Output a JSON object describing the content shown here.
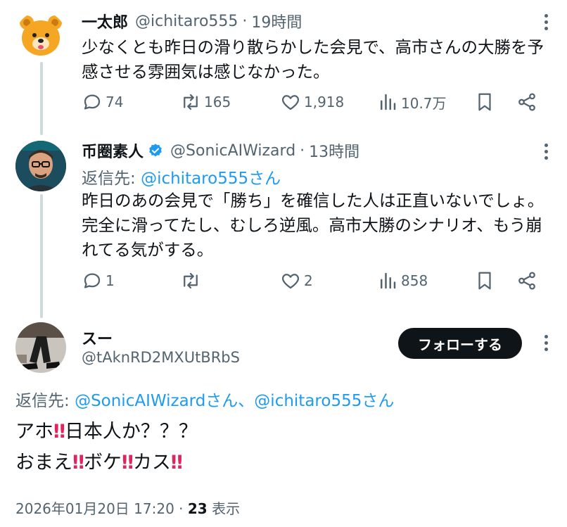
{
  "tweets": [
    {
      "name": "一太郎",
      "handle": "@ichitaro555",
      "dot": "·",
      "time": "19時間",
      "text_lines": [
        "少なくとも昨日の滑り散らかした会見で、高市さんの大勝を予",
        "感させる雰囲気は感じなかった。"
      ],
      "actions": {
        "reply": "74",
        "retweet": "165",
        "like": "1,918",
        "views": "10.7万"
      }
    },
    {
      "name": "币圈素人",
      "verified": true,
      "handle": "@SonicAIWizard",
      "dot": "·",
      "time": "13時間",
      "reply_prefix": "返信先: ",
      "reply_target": "@ichitaro555さん",
      "text_lines": [
        "昨日のあの会見で「勝ち」を確信した人は正直いないでしょ。",
        "完全に滑ってたし、むしろ逆風。高市大勝のシナリオ、もう崩",
        "れてる気がする。"
      ],
      "actions": {
        "reply": "1",
        "retweet": "",
        "like": "2",
        "views": "858"
      }
    }
  ],
  "main_tweet": {
    "name": "スー",
    "handle": "@tAknRD2MXUtBRbS",
    "follow_label": "フォローする",
    "reply_prefix": "返信先: ",
    "reply_target": "@SonicAIWizardさん、@ichitaro555さん",
    "line1_a": "アホ",
    "line1_b": "日本人か？？？",
    "line2_a": "おまえ",
    "line2_b": "ボケ",
    "line2_c": "カス",
    "bang": "‼",
    "timestamp": "2026年01月20日 17:20",
    "dot": "·",
    "views_count": "23",
    "views_label": " 表示"
  },
  "colors": {
    "accent": "#1d9bf0",
    "text": "#0f1419",
    "muted": "#536471",
    "line": "#cfd9de"
  },
  "icons": [
    "reply-icon",
    "retweet-icon",
    "like-icon",
    "views-icon",
    "bookmark-icon",
    "share-icon",
    "verified-icon",
    "more-icon"
  ]
}
